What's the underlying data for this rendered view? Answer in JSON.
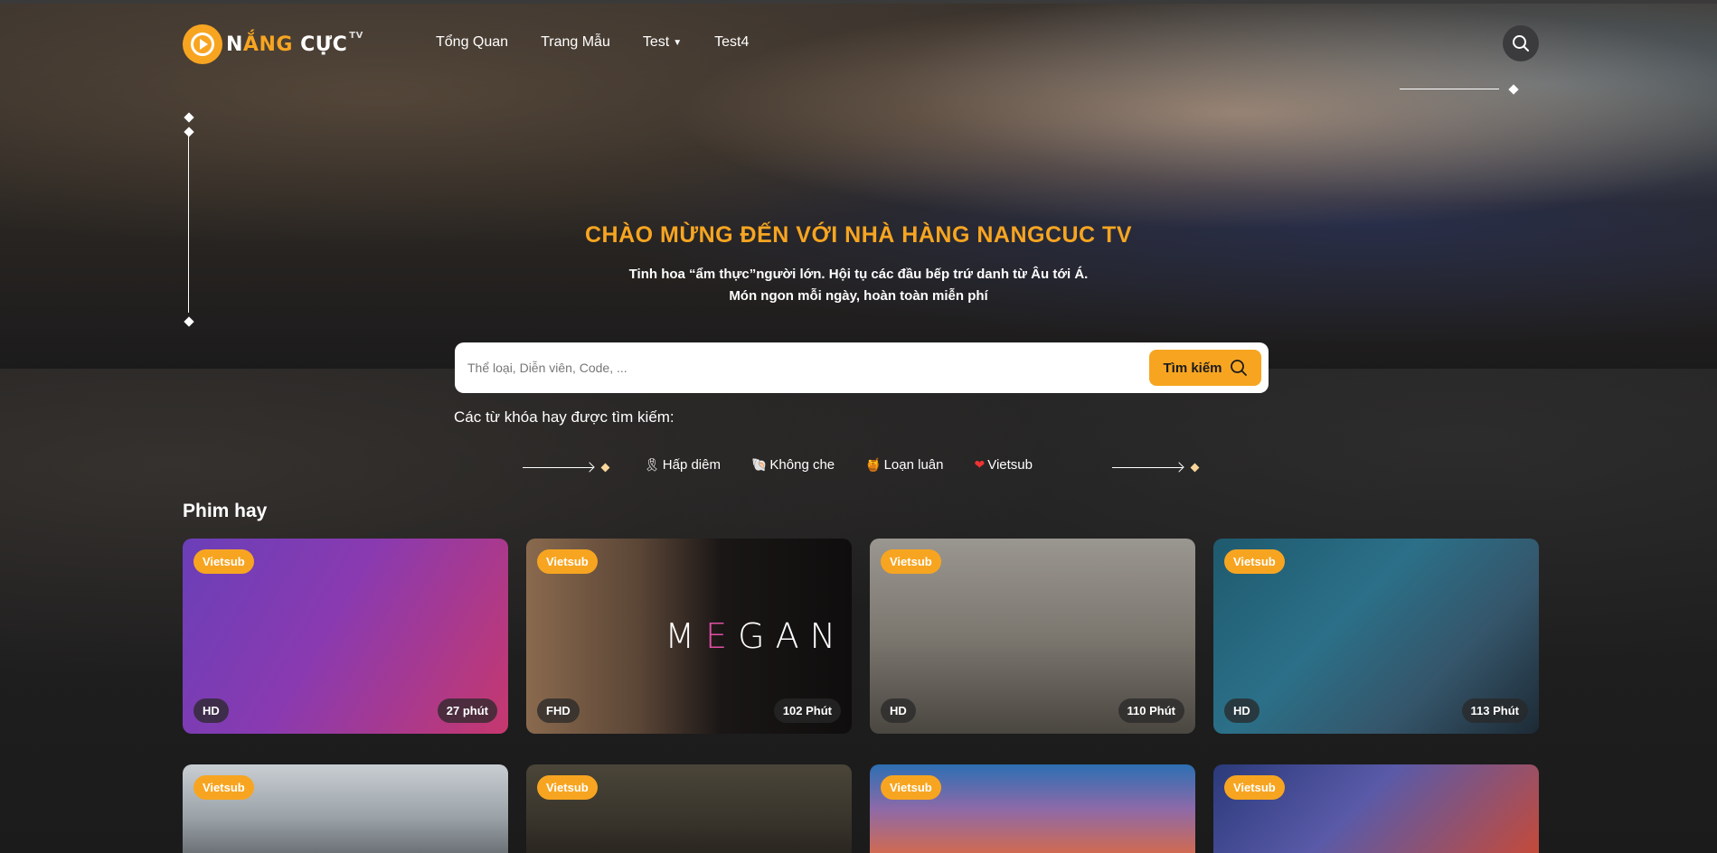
{
  "header": {
    "logo_prefix": "N",
    "logo_accent": "ẮNG",
    "logo_rest": " CỰC",
    "logo_tv": "TV",
    "nav": [
      {
        "label": "Tổng Quan"
      },
      {
        "label": "Trang Mẫu"
      },
      {
        "label": "Test"
      },
      {
        "label": "Test4"
      }
    ]
  },
  "hero": {
    "title": "CHÀO MỪNG ĐẾN VỚI NHÀ HÀNG NANGCUC TV",
    "subtitle_line1": "Tinh hoa “ẩm thực”người lớn. Hội tụ các đầu bếp trứ danh từ Âu tới Á.",
    "subtitle_line2": "Món ngon mỗi ngày, hoàn toàn miễn phí"
  },
  "search": {
    "placeholder": "Thể loại, Diễn viên, Code, ...",
    "value": "",
    "button_label": "Tìm kiếm"
  },
  "keywords": {
    "title": "Các từ khóa hay được tìm kiếm:",
    "items": [
      {
        "emoji": "🎗",
        "label": "Hấp diêm"
      },
      {
        "emoji": "🐚",
        "label": "Không che"
      },
      {
        "emoji": "🍯",
        "label": "Loạn luân"
      },
      {
        "emoji": "❤",
        "label": "Vietsub"
      }
    ]
  },
  "section": {
    "title": "Phim hay"
  },
  "cards": [
    {
      "tag": "Vietsub",
      "quality": "HD",
      "duration": "27 phút"
    },
    {
      "tag": "Vietsub",
      "quality": "FHD",
      "duration": "102 Phút",
      "poster_text_a": "M",
      "poster_text_e": "E",
      "poster_text_b": "GAN"
    },
    {
      "tag": "Vietsub",
      "quality": "HD",
      "duration": "110 Phút"
    },
    {
      "tag": "Vietsub",
      "quality": "HD",
      "duration": "113 Phút"
    },
    {
      "tag": "Vietsub"
    },
    {
      "tag": "Vietsub"
    },
    {
      "tag": "Vietsub"
    },
    {
      "tag": "Vietsub"
    }
  ],
  "colors": {
    "accent": "#f7a521",
    "background": "#1a1a1c"
  },
  "icons": [
    "play-logo-icon",
    "chevron-down-icon",
    "search-icon"
  ]
}
